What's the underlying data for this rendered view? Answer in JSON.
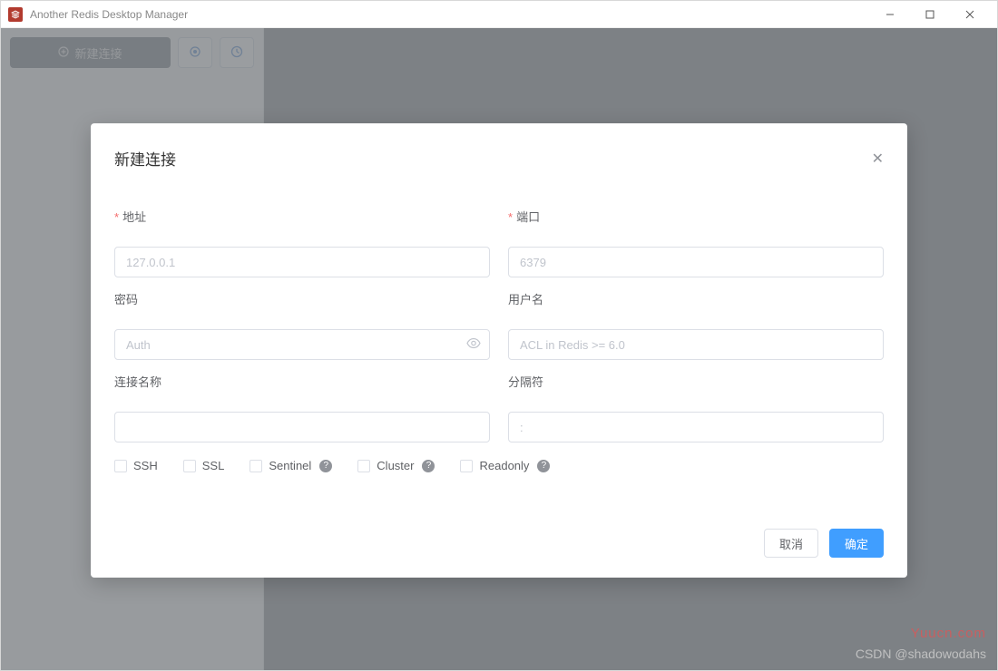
{
  "window": {
    "title": "Another Redis Desktop Manager"
  },
  "sidebar": {
    "new_connection_label": "新建连接"
  },
  "dialog": {
    "title": "新建连接",
    "host_label": "地址",
    "host_placeholder": "127.0.0.1",
    "port_label": "端口",
    "port_placeholder": "6379",
    "password_label": "密码",
    "password_placeholder": "Auth",
    "username_label": "用户名",
    "username_placeholder": "ACL in Redis >= 6.0",
    "name_label": "连接名称",
    "separator_label": "分隔符",
    "separator_placeholder": ":",
    "checkboxes": {
      "ssh": "SSH",
      "ssl": "SSL",
      "sentinel": "Sentinel",
      "cluster": "Cluster",
      "readonly": "Readonly"
    },
    "cancel_label": "取消",
    "confirm_label": "确定"
  },
  "watermarks": {
    "site": "Yuucn.com",
    "csdn": "CSDN @shadowodahs"
  }
}
